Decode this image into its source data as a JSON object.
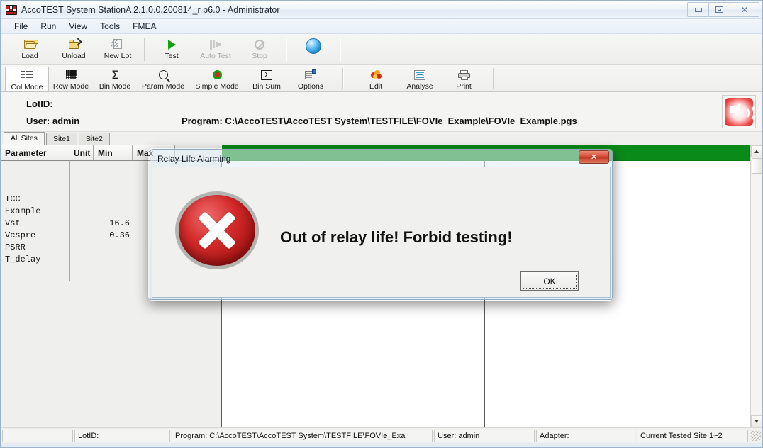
{
  "window": {
    "title": "AccoTEST System StationA  2.1.0.0.200814_r p6.0 - Administrator",
    "app_icon": "accotest-logo-icon",
    "controls": {
      "minimize": "minimize-icon",
      "restore": "restore-icon",
      "close": "close-icon"
    }
  },
  "menubar": {
    "items": [
      {
        "label": "File"
      },
      {
        "label": "Run"
      },
      {
        "label": "View"
      },
      {
        "label": "Tools"
      },
      {
        "label": "FMEA"
      }
    ]
  },
  "toolbar_primary": {
    "buttons": [
      {
        "label": "Load",
        "icon": "open-folder-icon",
        "enabled": true
      },
      {
        "label": "Unload",
        "icon": "close-folder-icon",
        "enabled": true
      },
      {
        "label": "New Lot",
        "icon": "new-lot-icon",
        "enabled": true
      },
      {
        "label": "Test",
        "icon": "play-icon",
        "enabled": true
      },
      {
        "label": "Auto Test",
        "icon": "fast-forward-icon",
        "enabled": false
      },
      {
        "label": "Stop",
        "icon": "no-entry-icon",
        "enabled": false
      }
    ],
    "status_sphere": "blue-sphere-icon"
  },
  "toolbar_secondary": {
    "buttons": [
      {
        "label": "Col Mode",
        "icon": "column-mode-icon",
        "selected": true
      },
      {
        "label": "Row Mode",
        "icon": "row-mode-icon",
        "selected": false
      },
      {
        "label": "Bin Mode",
        "icon": "sigma-icon",
        "selected": false
      },
      {
        "label": "Param Mode",
        "icon": "magnifier-icon",
        "selected": false
      },
      {
        "label": "Simple Mode",
        "icon": "ring-icon",
        "selected": false
      },
      {
        "label": "Bin Sum",
        "icon": "bin-sum-icon",
        "selected": false
      },
      {
        "label": "Options",
        "icon": "options-icon",
        "selected": false
      },
      {
        "label": "Edit",
        "icon": "edit-icon",
        "selected": false
      },
      {
        "label": "Analyse",
        "icon": "analyse-icon",
        "selected": false
      },
      {
        "label": "Print",
        "icon": "printer-icon",
        "selected": false
      }
    ]
  },
  "info_panel": {
    "lotid_label": "LotID:",
    "lotid_value": "",
    "user_label": "User: admin",
    "program_label": "Program: C:\\AccoTEST\\AccoTEST System\\TESTFILE\\FOVIe_Example\\FOVIe_Example.pgs",
    "sound_button_icon": "speaker-icon"
  },
  "tabs": [
    {
      "label": "All Sites",
      "active": true
    },
    {
      "label": "Site1",
      "active": false
    },
    {
      "label": "Site2",
      "active": false
    }
  ],
  "table": {
    "headers": [
      "Parameter",
      "Unit",
      "Min",
      "Max"
    ],
    "rows": [
      {
        "parameter": "ICC",
        "unit": "",
        "min": "",
        "max": ""
      },
      {
        "parameter": "Example",
        "unit": "",
        "min": "",
        "max": ""
      },
      {
        "parameter": "Vst",
        "unit": "",
        "min": "16.6",
        "max": ""
      },
      {
        "parameter": "Vcspre",
        "unit": "",
        "min": "0.36",
        "max": ""
      },
      {
        "parameter": "PSRR",
        "unit": "",
        "min": "",
        "max": ""
      },
      {
        "parameter": "T_delay",
        "unit": "",
        "min": "",
        "max": ""
      }
    ]
  },
  "content": {
    "green_bar_color": "#0a8a18",
    "green_bar_button_icon": "restore-small-icon",
    "scrollbar": {
      "up_icon": "scroll-up-arrow-icon",
      "down_icon": "scroll-down-arrow-icon"
    }
  },
  "dialog": {
    "title": "Relay Life Alarming",
    "close_icon": "close-icon",
    "error_icon": "error-cross-icon",
    "message": "Out of relay life! Forbid testing!",
    "ok_label": "OK"
  },
  "statusbar": {
    "panels": [
      {
        "text": "LotID:"
      },
      {
        "text": "Program: C:\\AccoTEST\\AccoTEST System\\TESTFILE\\FOVIe_Exa"
      },
      {
        "text": "User: admin"
      },
      {
        "text": "Adapter:"
      },
      {
        "text": "Current Tested Site:1~2"
      }
    ]
  }
}
